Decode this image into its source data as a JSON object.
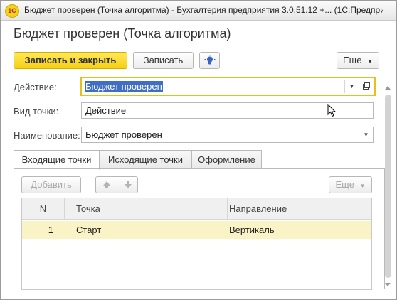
{
  "window": {
    "app_logo": "1С",
    "title": "Бюджет проверен (Точка алгоритма) - Бухгалтерия предприятия 3.0.51.12 +... (1С:Предприятие)"
  },
  "form": {
    "title": "Бюджет проверен (Точка алгоритма)"
  },
  "toolbar": {
    "save_close_label": "Записать и закрыть",
    "save_label": "Записать",
    "more_label": "Еще"
  },
  "fields": {
    "action": {
      "label": "Действие:",
      "value": "Бюджет проверен"
    },
    "point_type": {
      "label": "Вид точки:",
      "value": "Действие"
    },
    "name": {
      "label": "Наименование:",
      "value": "Бюджет проверен"
    }
  },
  "tabs": [
    {
      "label": "Входящие точки",
      "active": true
    },
    {
      "label": "Исходящие точки",
      "active": false
    },
    {
      "label": "Оформление",
      "active": false
    }
  ],
  "table_toolbar": {
    "add_label": "Добавить",
    "more_label": "Еще"
  },
  "table": {
    "columns": [
      "N",
      "Точка",
      "Направление"
    ],
    "rows": [
      {
        "n": "1",
        "point": "Старт",
        "direction": "Вертикаль"
      }
    ]
  },
  "colors": {
    "primary_button": "#f6cf13",
    "selection": "#3f6ec3",
    "row_highlight": "#faf3c6",
    "active_field_border": "#e6c11c"
  }
}
